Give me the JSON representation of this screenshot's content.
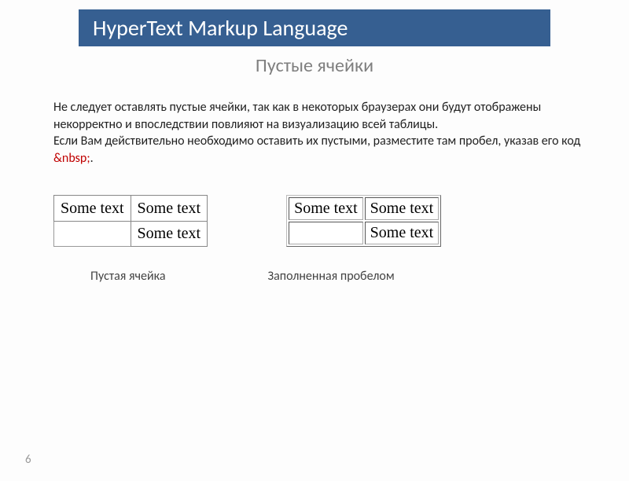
{
  "header": {
    "title": "HyperText Markup Language"
  },
  "subtitle": "Пустые ячейки",
  "paragraph": {
    "line1": "Не следует оставлять пустые ячейки, так как в некоторых браузерах они будут отображены некорректно и впоследствии повлияют на визуализацию всей таблицы.",
    "line2_a": "Если Вам действительно необходимо оставить их пустыми, разместите там пробел, указав его код ",
    "nbsp_code": "&nbsp;",
    "line2_b": "."
  },
  "tables": {
    "left": {
      "rows": [
        [
          "Some text",
          "Some text"
        ],
        [
          "",
          "Some text"
        ]
      ]
    },
    "right": {
      "rows": [
        [
          "Some text",
          "Some text"
        ],
        [
          " ",
          "Some text"
        ]
      ]
    }
  },
  "captions": {
    "left": "Пустая ячейка",
    "right": "Заполненная пробелом"
  },
  "page_number": "6"
}
